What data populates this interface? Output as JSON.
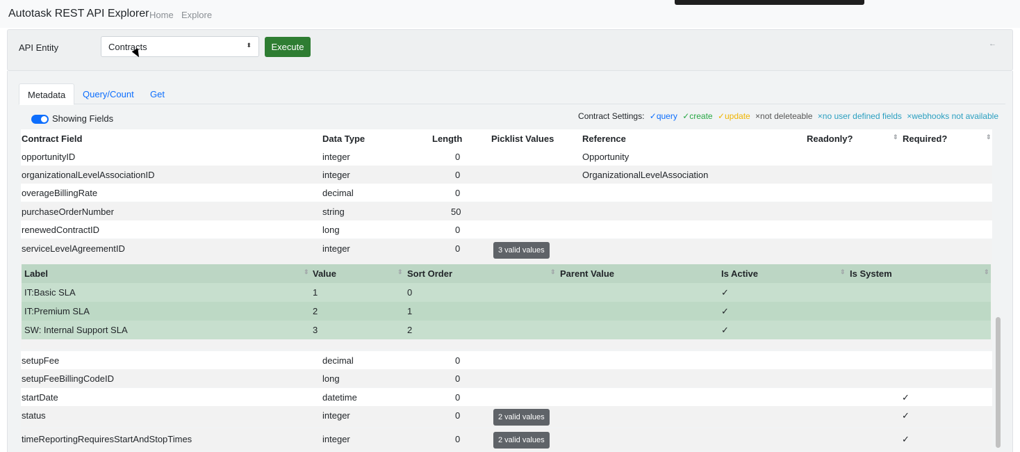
{
  "navbar": {
    "brand": "Autotask REST API Explorer",
    "links": [
      "Home",
      "Explore"
    ]
  },
  "entity_panel": {
    "label": "API Entity",
    "selected": "Contracts",
    "select_arrows": "⬍",
    "execute": "Execute",
    "collapse_icon": "←"
  },
  "tabs": [
    "Metadata",
    "Query/Count",
    "Get"
  ],
  "toggle_label": "Showing Fields",
  "settings": {
    "label": "Contract Settings:",
    "items": [
      {
        "text": "✓query",
        "color": "#0d6efd"
      },
      {
        "text": "✓create",
        "color": "#28a745"
      },
      {
        "text": "✓update",
        "color": "#f0b400"
      },
      {
        "text": "×not deleteable",
        "color": "#555555"
      },
      {
        "text": "×no user defined fields",
        "color": "#2a9fc0"
      },
      {
        "text": "×webhooks not available",
        "color": "#2a9fc0"
      }
    ]
  },
  "table": {
    "headers": {
      "field": "Contract Field",
      "type": "Data Type",
      "length": "Length",
      "picklist": "Picklist Values",
      "reference": "Reference",
      "readonly": "Readonly?",
      "required": "Required?"
    },
    "rows_top": [
      {
        "field": "opportunityID",
        "type": "integer",
        "length": "0",
        "reference": "Opportunity"
      },
      {
        "field": "organizationalLevelAssociationID",
        "type": "integer",
        "length": "0",
        "reference": "OrganizationalLevelAssociation"
      },
      {
        "field": "overageBillingRate",
        "type": "decimal",
        "length": "0",
        "reference": ""
      },
      {
        "field": "purchaseOrderNumber",
        "type": "string",
        "length": "50",
        "reference": ""
      },
      {
        "field": "renewedContractID",
        "type": "long",
        "length": "0",
        "reference": ""
      },
      {
        "field": "serviceLevelAgreementID",
        "type": "integer",
        "length": "0",
        "reference": "",
        "badge": "3 valid values"
      }
    ],
    "rows_bottom": [
      {
        "field": "setupFee",
        "type": "decimal",
        "length": "0",
        "required": ""
      },
      {
        "field": "setupFeeBillingCodeID",
        "type": "long",
        "length": "0",
        "required": ""
      },
      {
        "field": "startDate",
        "type": "datetime",
        "length": "0",
        "required": "✓"
      },
      {
        "field": "status",
        "type": "integer",
        "length": "0",
        "required": "✓",
        "badge": "2 valid values"
      },
      {
        "field": "timeReportingRequiresStartAndStopTimes",
        "type": "integer",
        "length": "0",
        "required": "✓",
        "badge": "2 valid values"
      }
    ]
  },
  "picklist": {
    "headers": {
      "label": "Label",
      "value": "Value",
      "sort": "Sort Order",
      "parent": "Parent Value",
      "active": "Is Active",
      "system": "Is System"
    },
    "rows": [
      {
        "label": "IT:Basic SLA",
        "value": "1",
        "sort": "0",
        "active": "✓"
      },
      {
        "label": "IT:Premium SLA",
        "value": "2",
        "sort": "1",
        "active": "✓"
      },
      {
        "label": "SW: Internal Support SLA",
        "value": "3",
        "sort": "2",
        "active": "✓"
      }
    ]
  },
  "sort_glyph": "⇕"
}
